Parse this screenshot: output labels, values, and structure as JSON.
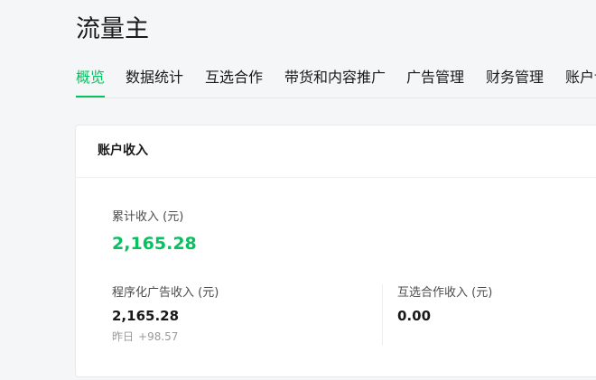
{
  "page": {
    "title": "流量主"
  },
  "tabs": [
    {
      "label": "概览",
      "active": true
    },
    {
      "label": "数据统计",
      "active": false
    },
    {
      "label": "互选合作",
      "active": false
    },
    {
      "label": "带货和内容推广",
      "active": false
    },
    {
      "label": "广告管理",
      "active": false
    },
    {
      "label": "财务管理",
      "active": false
    },
    {
      "label": "账户设置",
      "active": false
    }
  ],
  "income_card": {
    "title": "账户收入",
    "total": {
      "label": "累计收入 (元)",
      "value": "2,165.28"
    },
    "programmatic": {
      "label": "程序化广告收入 (元)",
      "value": "2,165.28",
      "compare_label": "昨日",
      "compare_value": "+98.57"
    },
    "cooperation": {
      "label": "互选合作收入 (元)",
      "value": "0.00"
    }
  },
  "colors": {
    "accent": "#07c160",
    "text_primary": "#191919",
    "text_secondary": "#4c4c4c",
    "text_muted": "#9a9a9a",
    "page_background": "#f5f6f7"
  }
}
